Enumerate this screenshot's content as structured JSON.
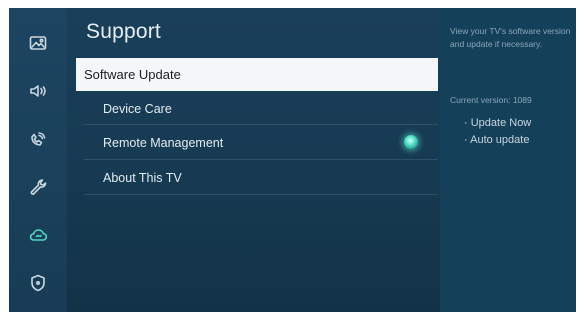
{
  "header": {
    "title": "Support"
  },
  "sidebar": {
    "icons": [
      {
        "name": "picture-icon"
      },
      {
        "name": "sound-icon"
      },
      {
        "name": "broadcast-icon"
      },
      {
        "name": "wrench-icon"
      },
      {
        "name": "cloud-icon",
        "active": true
      },
      {
        "name": "shield-icon"
      }
    ]
  },
  "menu": {
    "items": [
      {
        "label": "Software Update",
        "selected": true
      },
      {
        "label": "Device Care"
      },
      {
        "label": "Remote Management",
        "indicator": "on"
      },
      {
        "label": "About This TV"
      }
    ]
  },
  "info": {
    "description": "View your TV's software version and update if necessary.",
    "current_version": "Current version: 1089",
    "options": [
      "· Update Now",
      "· Auto update"
    ]
  },
  "colors": {
    "accent": "#4fd9c3",
    "background": "#163a52",
    "selected_bg": "#f4f6f8"
  }
}
